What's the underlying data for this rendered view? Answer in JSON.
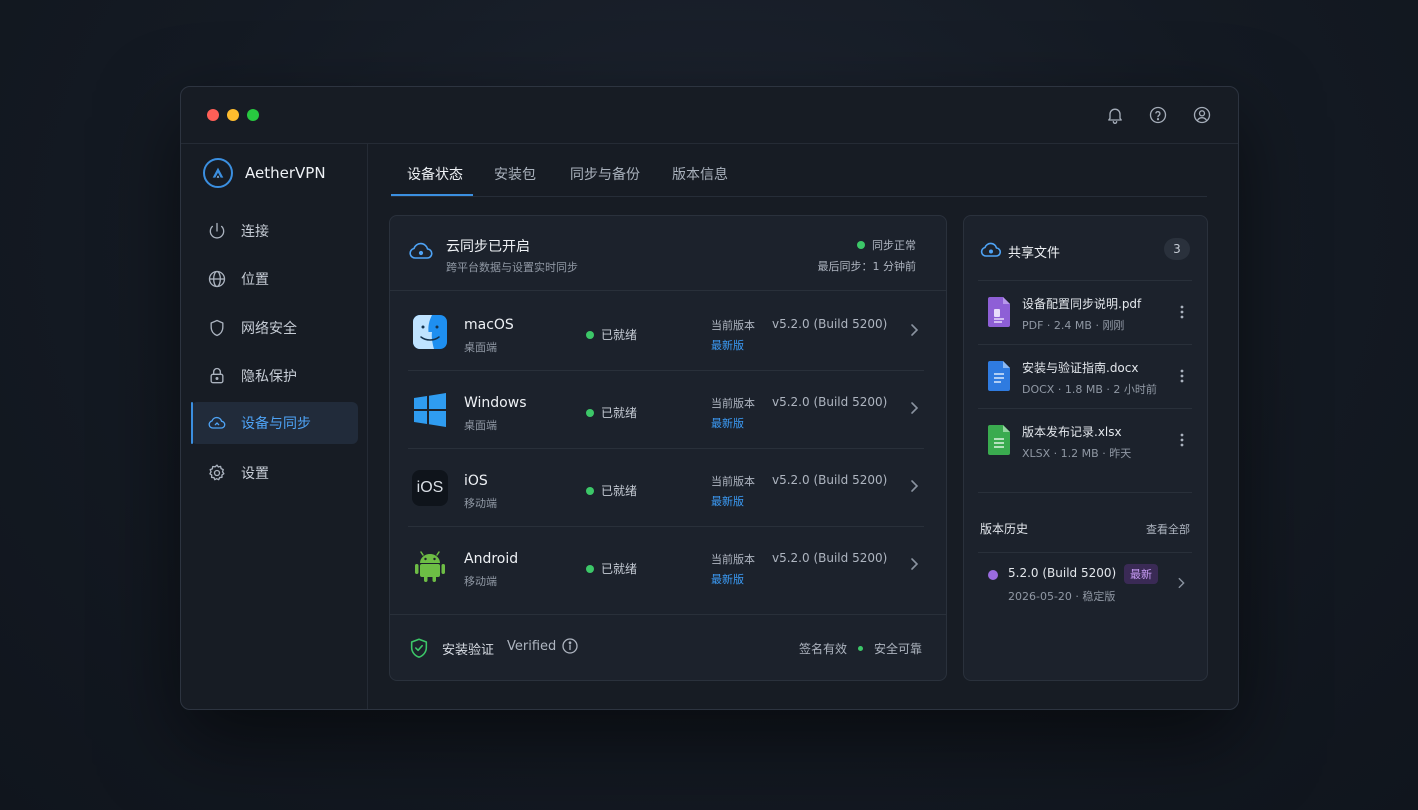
{
  "app": {
    "name": "AetherVPN"
  },
  "sidebar": {
    "items": [
      {
        "label": "连接",
        "icon": "power-icon"
      },
      {
        "label": "位置",
        "icon": "globe-icon"
      },
      {
        "label": "网络安全",
        "icon": "shield-icon"
      },
      {
        "label": "隐私保护",
        "icon": "lock-icon"
      },
      {
        "label": "设备与同步",
        "icon": "cloud-sync-icon",
        "active": true
      },
      {
        "label": "设置",
        "icon": "gear-icon"
      }
    ]
  },
  "tabs": [
    {
      "label": "设备状态",
      "active": true
    },
    {
      "label": "安装包"
    },
    {
      "label": "同步与备份"
    },
    {
      "label": "版本信息"
    }
  ],
  "sync": {
    "title": "云同步已开启",
    "subtitle": "跨平台数据与设置实时同步",
    "status": "同步正常",
    "last_sync": "最后同步：1 分钟前"
  },
  "devices": [
    {
      "name": "macOS",
      "type": "桌面端",
      "status": "已就绪",
      "version_label": "当前版本",
      "version": "v5.2.0 (Build 5200)",
      "latest": "最新版",
      "icon": "macos-finder-icon"
    },
    {
      "name": "Windows",
      "type": "桌面端",
      "status": "已就绪",
      "version_label": "当前版本",
      "version": "v5.2.0 (Build 5200)",
      "latest": "最新版",
      "icon": "windows-logo-icon"
    },
    {
      "name": "iOS",
      "type": "移动端",
      "status": "已就绪",
      "version_label": "当前版本",
      "version": "v5.2.0 (Build 5200)",
      "latest": "最新版",
      "icon": "ios-icon",
      "icon_text": "iOS"
    },
    {
      "name": "Android",
      "type": "移动端",
      "status": "已就绪",
      "version_label": "当前版本",
      "version": "v5.2.0 (Build 5200)",
      "latest": "最新版",
      "icon": "android-icon"
    }
  ],
  "verify": {
    "title": "安装验证",
    "title_en": "Verified",
    "signature": "签名有效",
    "safe": "安全可靠"
  },
  "shared": {
    "title": "共享文件",
    "count": "3",
    "files": [
      {
        "name": "设备配置同步说明.pdf",
        "meta": "PDF · 2.4 MB · 刚刚",
        "color": "#8e5fd6"
      },
      {
        "name": "安装与验证指南.docx",
        "meta": "DOCX · 1.8 MB · 2 小时前",
        "color": "#2f7be0"
      },
      {
        "name": "版本发布记录.xlsx",
        "meta": "XLSX · 1.2 MB · 昨天",
        "color": "#3aab4f"
      }
    ]
  },
  "history": {
    "title": "版本历史",
    "view_all": "查看全部",
    "items": [
      {
        "version": "5.2.0 (Build 5200)",
        "badge": "最新",
        "meta": "2026-05-20 · 稳定版"
      }
    ]
  },
  "colors": {
    "accent": "#3b8fe0",
    "ok": "#3cc768",
    "badge_purple": "#c89cf5"
  }
}
